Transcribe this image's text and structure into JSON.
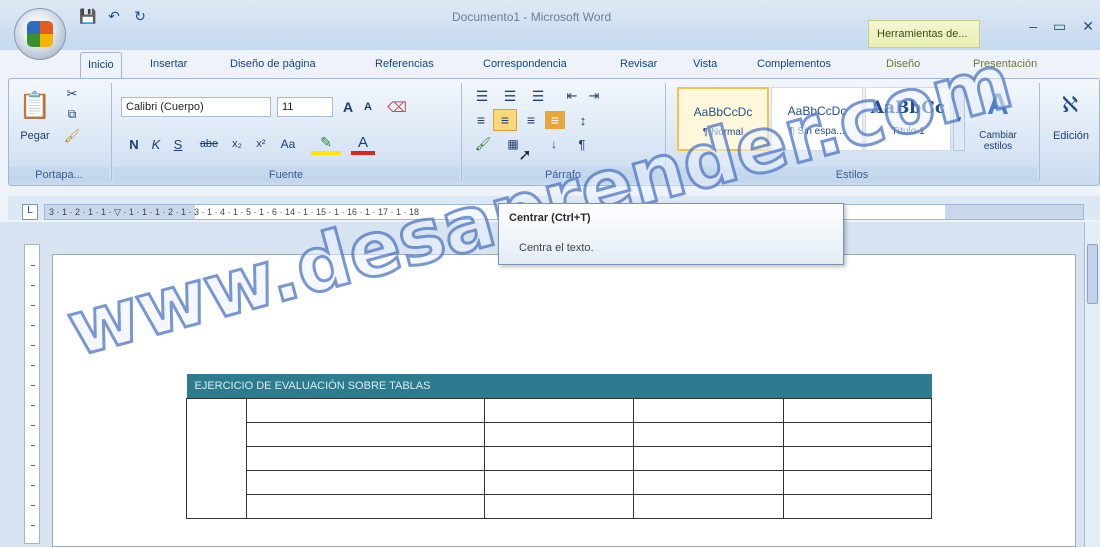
{
  "window": {
    "title": "Documento1 - Microsoft Word",
    "contextual_tab": "Herramientas de...",
    "controls": [
      "–",
      "▭",
      "✕"
    ]
  },
  "qat": {
    "save": "💾",
    "undo": "↶",
    "redo": "↻"
  },
  "tabs": [
    {
      "label": "Inicio",
      "active": true
    },
    {
      "label": "Insertar"
    },
    {
      "label": "Diseño de página"
    },
    {
      "label": "Referencias"
    },
    {
      "label": "Correspondencia"
    },
    {
      "label": "Revisar"
    },
    {
      "label": "Vista"
    },
    {
      "label": "Complementos"
    },
    {
      "label": "Diseño"
    },
    {
      "label": "Presentación"
    }
  ],
  "ribbon": {
    "clipboard": {
      "paste": "Pegar",
      "label": "Portapa..."
    },
    "font": {
      "family": "Calibri (Cuerpo)",
      "size": "11",
      "label": "Fuente",
      "bold": "N",
      "italic": "K",
      "underline": "S",
      "strike": "abe",
      "sub": "x₂",
      "sup": "x²",
      "case": "Aa",
      "grow": "A",
      "shrink": "A",
      "fontcolor": "A"
    },
    "paragraph": {
      "label": "Párrafo",
      "pilcrow": "¶"
    },
    "styles": {
      "label": "Estilos",
      "items": [
        {
          "sample": "AaBbCcDc",
          "name": "¶ Normal"
        },
        {
          "sample": "AaBbCcDc",
          "name": "¶ Sin espa..."
        },
        {
          "sample": "AaBbCc",
          "name": "Título 1"
        }
      ],
      "change": "Cambiar estilos"
    },
    "editing": {
      "label": "Edición"
    }
  },
  "ruler": {
    "numbers": "3 · 1 · 2 · 1 · 1 · ▽ · 1 · 1 · 1 · 2 · 1 · 3 · 1 · 4 · 1 · 5 · 1 · 6                                      · 14 · 1 · 15 · 1 · 16 · 1 · 17 · 1 · 18"
  },
  "tooltip": {
    "title": "Centrar (Ctrl+T)",
    "description": "Centra el texto."
  },
  "table": {
    "header": "EJERCICIO DE EVALUACIÓN SOBRE TABLAS",
    "rows": 5,
    "cols": 5
  },
  "watermark": "www.desaprender.com"
}
